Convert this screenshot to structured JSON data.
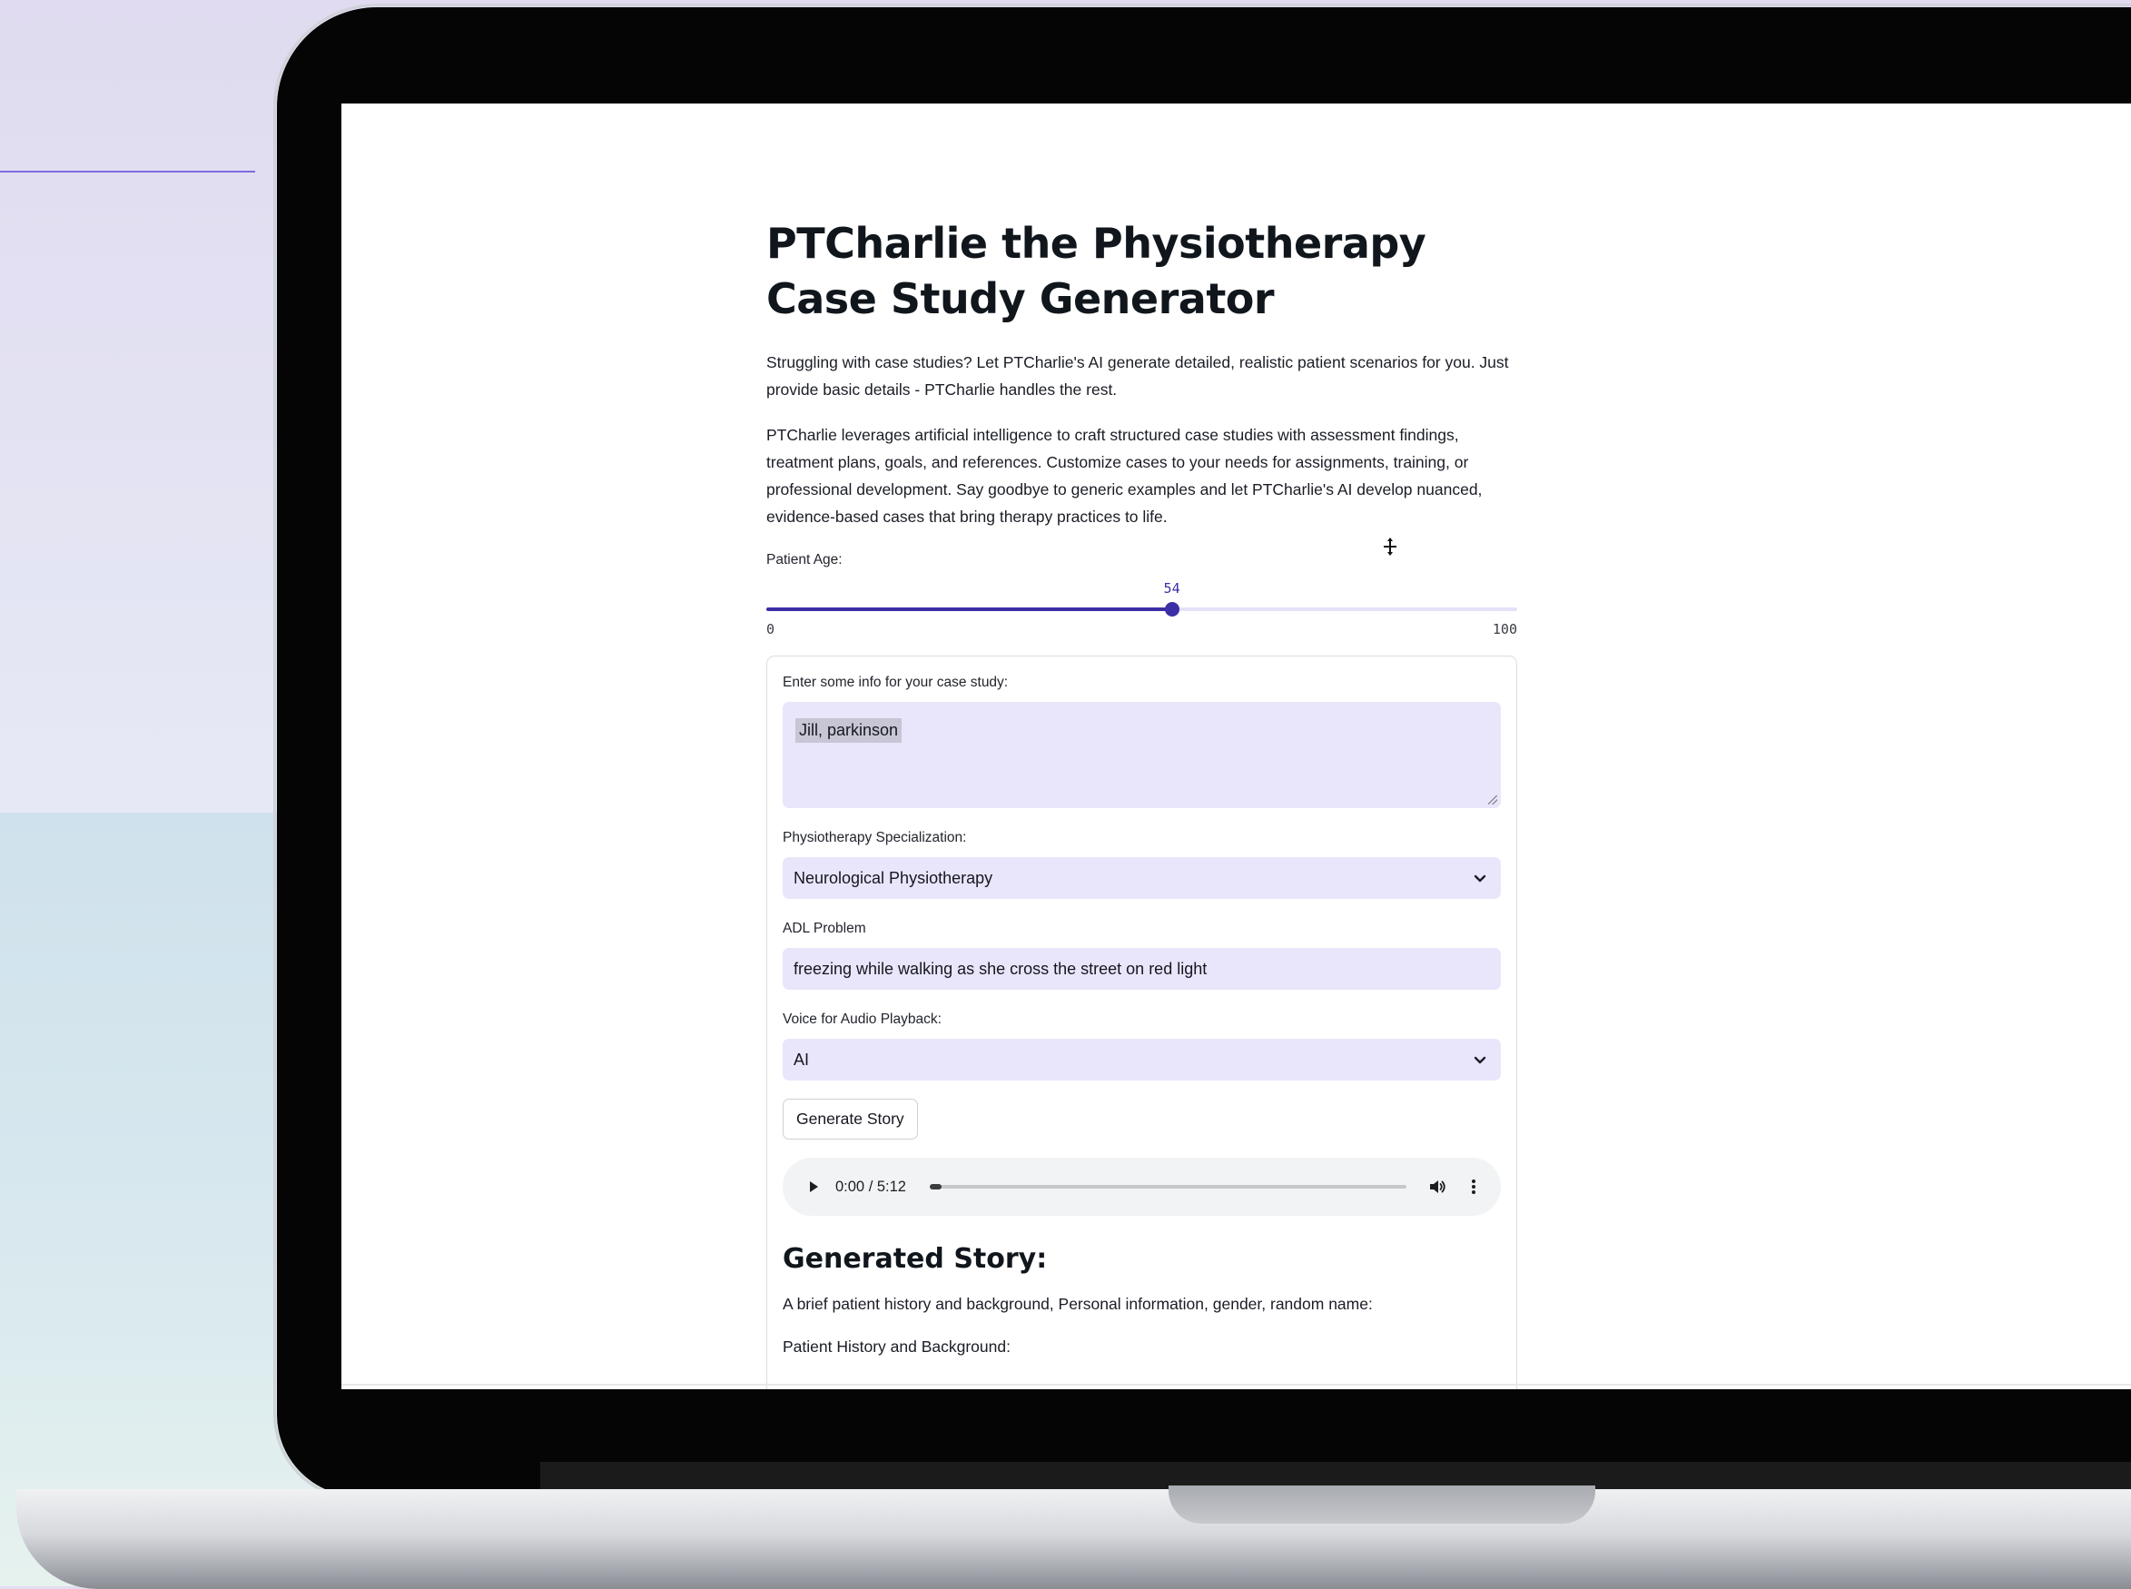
{
  "app": {
    "title": "PTCharlie the Physiotherapy Case Study Generator",
    "intro_1": "Struggling with case studies? Let PTCharlie's AI generate detailed, realistic patient scenarios for you. Just provide basic details - PTCharlie handles the rest.",
    "intro_2": "PTCharlie leverages artificial intelligence to craft structured case studies with assessment findings, treatment plans, goals, and references. Customize cases to your needs for assignments, training, or professional development. Say goodbye to generic examples and let PTCharlie's AI develop nuanced, evidence-based cases that bring therapy practices to life."
  },
  "age_slider": {
    "label": "Patient Age:",
    "value": 54,
    "min": 0,
    "max": 100,
    "value_text": "54",
    "min_text": "0",
    "max_text": "100"
  },
  "form": {
    "info_label": "Enter some info for your case study:",
    "info_value": "Jill, parkinson",
    "specialization_label": "Physiotherapy Specialization:",
    "specialization_value": "Neurological Physiotherapy",
    "adl_label": "ADL Problem",
    "adl_value": "freezing while walking as she cross the street on red light",
    "voice_label": "Voice for Audio Playback:",
    "voice_value": "AI",
    "generate_label": "Generate Story"
  },
  "audio": {
    "time_text": "0:00 / 5:12",
    "played_fraction": 0.025
  },
  "story": {
    "heading": "Generated Story:",
    "line_1": "A brief patient history and background, Personal information, gender, random name:",
    "line_2": "Patient History and Background:"
  },
  "icons": {
    "dropdown": "chevron-down-icon",
    "play": "play-icon",
    "volume": "volume-icon",
    "more": "more-vertical-icon",
    "cursor": "move-cursor-icon"
  },
  "colors": {
    "accent": "#3c2fa6",
    "input_bg": "#e9e6fb",
    "slider_track": "#e6e0f7"
  }
}
